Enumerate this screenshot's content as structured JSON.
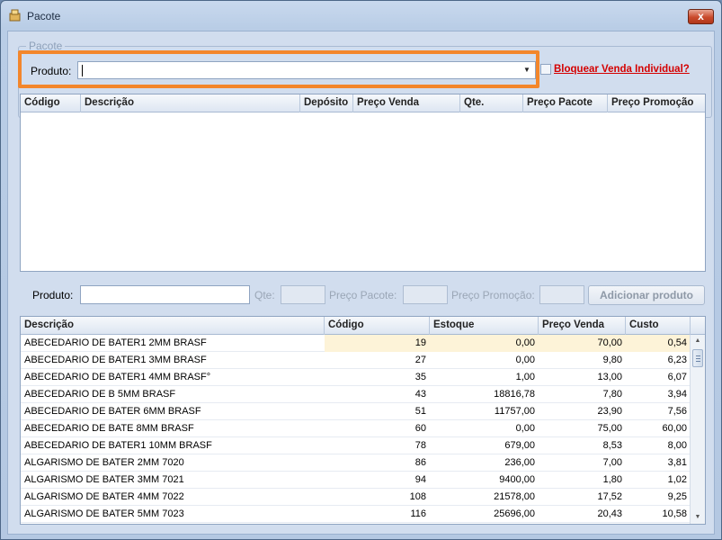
{
  "window": {
    "title": "Pacote",
    "close_label": "x"
  },
  "group": {
    "legend": "Pacote"
  },
  "top": {
    "produto_label": "Produto:",
    "produto_value": "",
    "bloquear_label": "Bloquear Venda Individual?"
  },
  "pacote_grid": {
    "columns": [
      "Código",
      "Descrição",
      "Depósito",
      "Preço Venda",
      "Qte.",
      "Preço Pacote",
      "Preço Promoção"
    ]
  },
  "add": {
    "produto_label": "Produto:",
    "qte_label": "Qte:",
    "preco_pacote_label": "Preço Pacote:",
    "preco_promocao_label": "Preço Promoção:",
    "button_label": "Adicionar produto"
  },
  "product_grid": {
    "columns": [
      "Descrição",
      "Código",
      "Estoque",
      "Preço Venda",
      "Custo"
    ],
    "rows": [
      [
        "ABECEDARIO DE BATER1 2MM BRASF",
        "19",
        "0,00",
        "70,00",
        "0,54"
      ],
      [
        "ABECEDARIO DE BATER1 3MM BRASF",
        "27",
        "0,00",
        "9,80",
        "6,23"
      ],
      [
        "ABECEDARIO DE BATER1 4MM BRASF°",
        "35",
        "1,00",
        "13,00",
        "6,07"
      ],
      [
        "ABECEDARIO DE B 5MM BRASF",
        "43",
        "18816,78",
        "7,80",
        "3,94"
      ],
      [
        "ABECEDARIO DE BATER 6MM BRASF",
        "51",
        "11757,00",
        "23,90",
        "7,56"
      ],
      [
        "ABECEDARIO DE BATE 8MM BRASF",
        "60",
        "0,00",
        "75,00",
        "60,00"
      ],
      [
        "ABECEDARIO DE BATER1 10MM BRASF",
        "78",
        "679,00",
        "8,53",
        "8,00"
      ],
      [
        "ALGARISMO DE BATER 2MM 7020",
        "86",
        "236,00",
        "7,00",
        "3,81"
      ],
      [
        "ALGARISMO DE BATER 3MM 7021",
        "94",
        "9400,00",
        "1,80",
        "1,02"
      ],
      [
        "ALGARISMO DE BATER 4MM 7022",
        "108",
        "21578,00",
        "17,52",
        "9,25"
      ],
      [
        "ALGARISMO DE BATER 5MM 7023",
        "116",
        "25696,00",
        "20,43",
        "10,58"
      ]
    ]
  }
}
